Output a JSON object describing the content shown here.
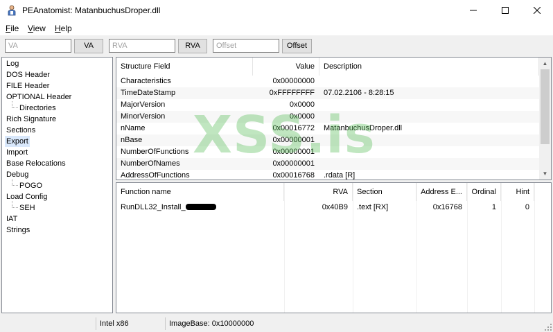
{
  "window": {
    "title": "PEAnatomist: MatanbuchusDroper.dll",
    "minimize_glyph": "—",
    "maximize_glyph": "☐",
    "close_glyph": "✕"
  },
  "menu": [
    {
      "label": "File",
      "accel": "F",
      "rest": "ile"
    },
    {
      "label": "View",
      "accel": "V",
      "rest": "iew"
    },
    {
      "label": "Help",
      "accel": "H",
      "rest": "elp"
    }
  ],
  "toolbar": {
    "va_placeholder": "VA",
    "va_button": "VA",
    "rva_placeholder": "RVA",
    "rva_button": "RVA",
    "offset_placeholder": "Offset",
    "offset_button": "Offset"
  },
  "tree": [
    {
      "label": "Log",
      "level": 0
    },
    {
      "label": "DOS Header",
      "level": 0
    },
    {
      "label": "FILE Header",
      "level": 0
    },
    {
      "label": "OPTIONAL Header",
      "level": 0
    },
    {
      "label": "Directories",
      "level": 1
    },
    {
      "label": "Rich Signature",
      "level": 0
    },
    {
      "label": "Sections",
      "level": 0
    },
    {
      "label": "Export",
      "level": 0,
      "selected": true
    },
    {
      "label": "Import",
      "level": 0
    },
    {
      "label": "Base Relocations",
      "level": 0
    },
    {
      "label": "Debug",
      "level": 0
    },
    {
      "label": "POGO",
      "level": 1
    },
    {
      "label": "Load Config",
      "level": 0
    },
    {
      "label": "SEH",
      "level": 1
    },
    {
      "label": "IAT",
      "level": 0
    },
    {
      "label": "Strings",
      "level": 0
    }
  ],
  "structure": {
    "columns": [
      "Structure Field",
      "Value",
      "Description"
    ],
    "rows": [
      {
        "field": "Characteristics",
        "value": "0x00000000",
        "description": ""
      },
      {
        "field": "TimeDateStamp",
        "value": "0xFFFFFFFF",
        "description": "07.02.2106 - 8:28:15"
      },
      {
        "field": "MajorVersion",
        "value": "0x0000",
        "description": ""
      },
      {
        "field": "MinorVersion",
        "value": "0x0000",
        "description": ""
      },
      {
        "field": "nName",
        "value": "0x00016772",
        "description": "MatanbuchusDroper.dll"
      },
      {
        "field": "nBase",
        "value": "0x00000001",
        "description": ""
      },
      {
        "field": "NumberOfFunctions",
        "value": "0x00000001",
        "description": ""
      },
      {
        "field": "NumberOfNames",
        "value": "0x00000001",
        "description": ""
      },
      {
        "field": "AddressOfFunctions",
        "value": "0x00016768",
        "description": ".rdata [R]"
      }
    ],
    "scroll_up": "▲",
    "scroll_down": "▼"
  },
  "functions": {
    "columns": [
      "Function name",
      "RVA",
      "Section",
      "Address E...",
      "Ordinal",
      "Hint"
    ],
    "rows": [
      {
        "name": "RunDLL32_Install_",
        "rva": "0x40B9",
        "section": ".text [RX]",
        "address": "0x16768",
        "ordinal": "1",
        "hint": "0"
      }
    ]
  },
  "watermark": "XSS.is",
  "status": {
    "arch": "Intel x86",
    "image_base": "ImageBase: 0x10000000"
  },
  "colors": {
    "selection": "#d9e8fb",
    "watermark": "#5abe5a",
    "border": "#828790"
  }
}
